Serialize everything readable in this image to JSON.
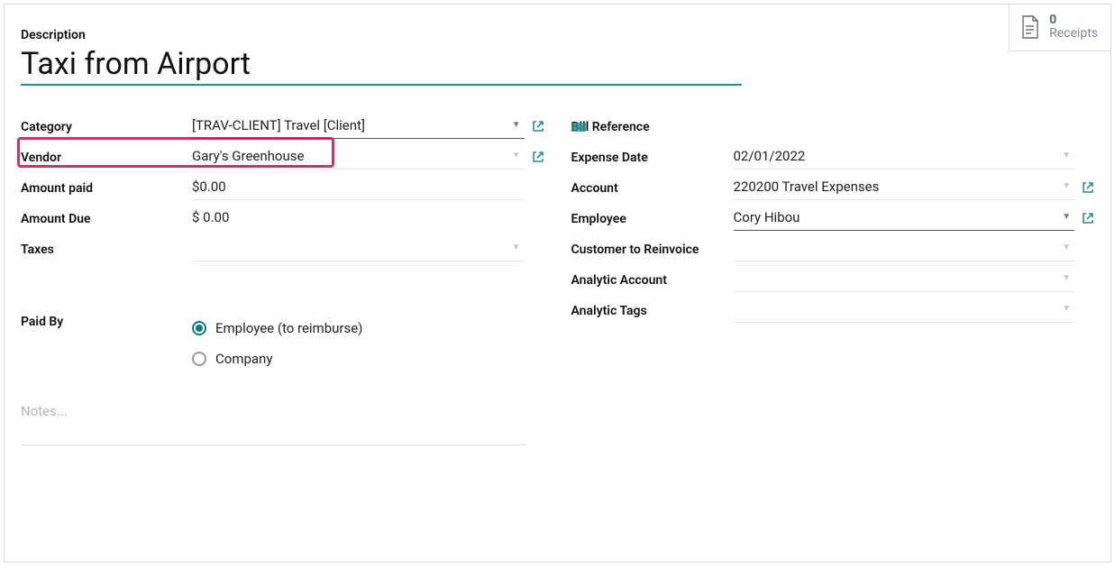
{
  "receipts": {
    "count": "0",
    "label": "Receipts"
  },
  "description": {
    "label": "Description",
    "value": "Taxi from Airport"
  },
  "left": {
    "category": {
      "label": "Category",
      "value": "[TRAV-CLIENT] Travel [Client]"
    },
    "vendor": {
      "label": "Vendor",
      "value": "Gary's Greenhouse"
    },
    "amount_paid": {
      "label": "Amount paid",
      "value": "$0.00"
    },
    "amount_due": {
      "label": "Amount Due",
      "value": "$ 0.00"
    },
    "taxes": {
      "label": "Taxes",
      "value": ""
    },
    "paid_by": {
      "label": "Paid By",
      "options": {
        "employee": "Employee (to reimburse)",
        "company": "Company"
      },
      "selected": "employee"
    }
  },
  "right": {
    "bill_reference": {
      "label": "Bill Reference",
      "value": ""
    },
    "expense_date": {
      "label": "Expense Date",
      "value": "02/01/2022"
    },
    "account": {
      "label": "Account",
      "value": "220200 Travel Expenses"
    },
    "employee": {
      "label": "Employee",
      "value": "Cory Hibou"
    },
    "customer_to_reinvoice": {
      "label": "Customer to Reinvoice",
      "value": ""
    },
    "analytic_account": {
      "label": "Analytic Account",
      "value": ""
    },
    "analytic_tags": {
      "label": "Analytic Tags",
      "value": ""
    }
  },
  "notes": {
    "placeholder": "Notes..."
  }
}
